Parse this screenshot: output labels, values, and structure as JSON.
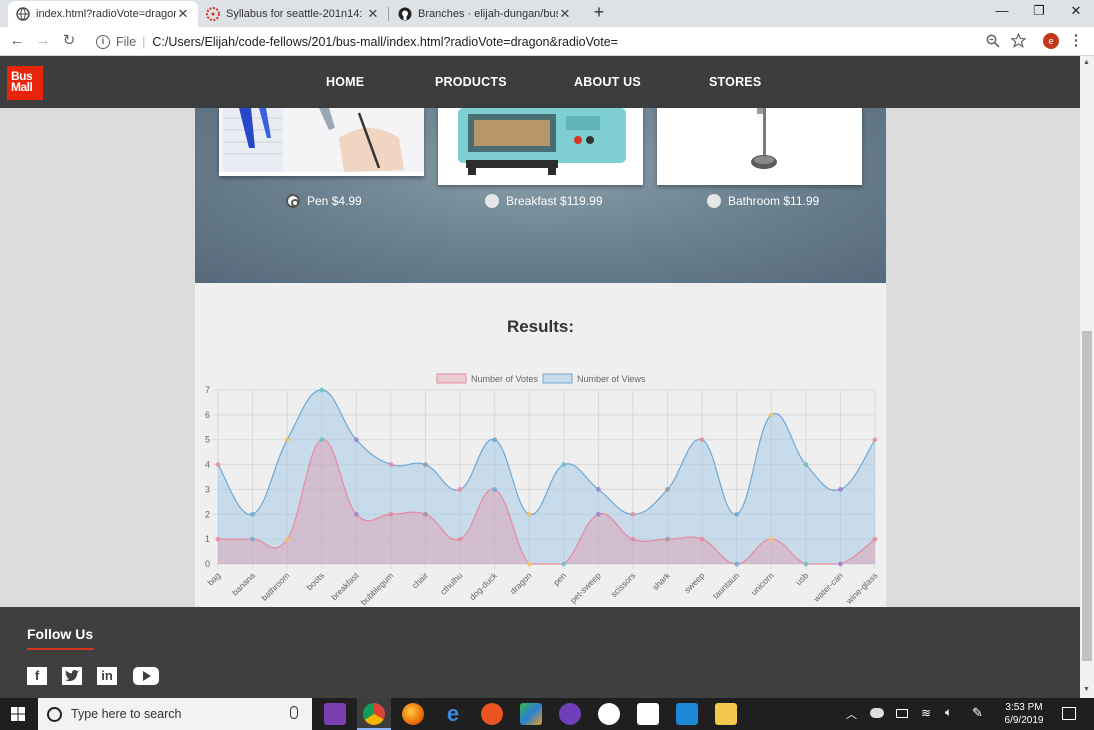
{
  "browser": {
    "tabs": [
      {
        "title": "index.html?radioVote=dragon&r",
        "active": true
      },
      {
        "title": "Syllabus for seattle-201n14: Foun",
        "active": false
      },
      {
        "title": "Branches · elijah-dungan/bus-m",
        "active": false
      }
    ],
    "address": {
      "scheme_label": "File",
      "url": "C:/Users/Elijah/code-fellows/201/bus-mall/index.html?radioVote=dragon&radioVote="
    },
    "profile_initial": "e"
  },
  "site": {
    "logo_line1": "Bus",
    "logo_line2": "Mall",
    "nav": [
      "HOME",
      "PRODUCTS",
      "ABOUT US",
      "STORES"
    ],
    "products": [
      {
        "label": "Pen $4.99",
        "selected": true
      },
      {
        "label": "Breakfast $119.99",
        "selected": false
      },
      {
        "label": "Bathroom $11.99",
        "selected": false
      }
    ],
    "results_title": "Results:",
    "footer": {
      "follow_title": "Follow Us",
      "social": [
        "facebook-icon",
        "twitter-icon",
        "linkedin-icon",
        "youtube-icon"
      ]
    }
  },
  "taskbar": {
    "search_placeholder": "Type here to search",
    "time": "3:53 PM",
    "date": "6/9/2019"
  },
  "chart_data": {
    "type": "line",
    "title": "",
    "legend": [
      "Number of Votes",
      "Number of Views"
    ],
    "legend_position": "top",
    "categories": [
      "bag",
      "banana",
      "bathroom",
      "boots",
      "breakfast",
      "bubblegum",
      "chair",
      "cthulhu",
      "dog-duck",
      "dragon",
      "pen",
      "pet-sweep",
      "scissors",
      "shark",
      "sweep",
      "tauntaun",
      "unicorn",
      "usb",
      "water-can",
      "wine-glass"
    ],
    "series": [
      {
        "name": "Number of Votes",
        "values": [
          1,
          1,
          1,
          5,
          2,
          2,
          2,
          1,
          3,
          0,
          0,
          2,
          1,
          1,
          1,
          0,
          1,
          0,
          0,
          1
        ],
        "color": "#e8899e",
        "fill": "rgba(232,137,158,0.35)"
      },
      {
        "name": "Number of Views",
        "values": [
          4,
          2,
          5,
          7,
          5,
          4,
          4,
          3,
          5,
          2,
          4,
          3,
          2,
          3,
          5,
          2,
          6,
          4,
          3,
          5
        ],
        "color": "#6fa9d6",
        "fill": "rgba(140,190,228,0.40)"
      }
    ],
    "ylim": [
      0,
      7
    ],
    "yticks": [
      0,
      1,
      2,
      3,
      4,
      5,
      6,
      7
    ],
    "grid": true,
    "smooth": true
  }
}
